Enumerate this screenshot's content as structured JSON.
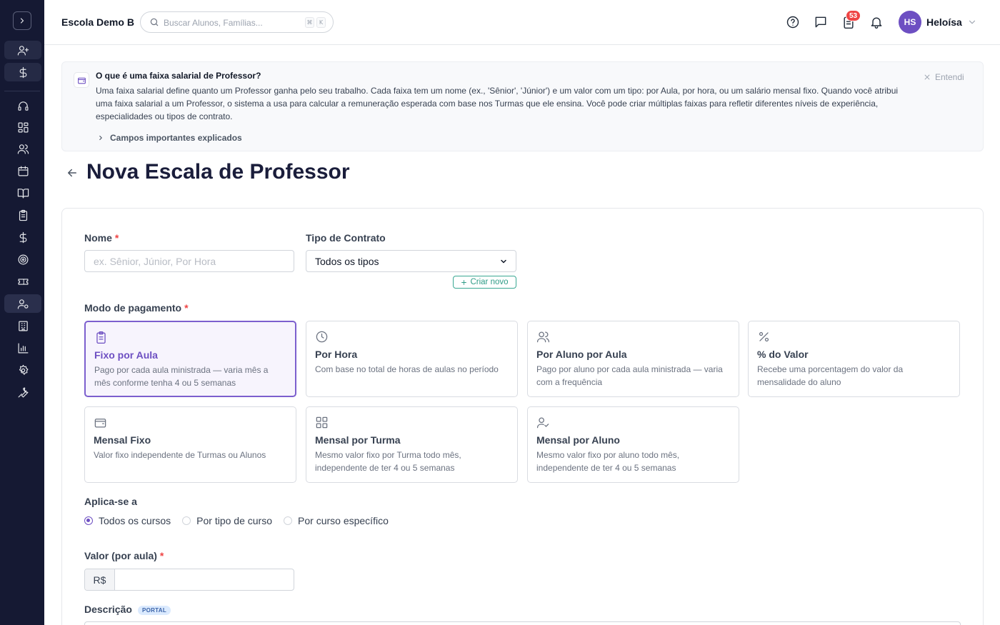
{
  "colors": {
    "sidebar_bg": "#151933",
    "accent": "#6d4fc2",
    "success": "#2f9c87",
    "badge": "#ef4444"
  },
  "sidebar": {
    "icons": [
      "chevron-right-icon",
      "user-plus-icon",
      "dollar-icon",
      "headset-icon",
      "dashboard-icon",
      "users-icon",
      "calendar-icon",
      "book-icon",
      "clipboard-icon",
      "dollar-icon",
      "target-icon",
      "ticket-icon",
      "user-cog-icon",
      "building-icon",
      "chart-icon",
      "settings-icon",
      "wrench-icon"
    ]
  },
  "topbar": {
    "school_name": "Escola Demo B",
    "search_placeholder": "Buscar Alunos, Famílias...",
    "shortcut_keys": [
      "⌘",
      "K"
    ],
    "notification_count": "53",
    "user_initials": "HS",
    "user_name": "Heloísa"
  },
  "banner": {
    "title": "O que é uma faixa salarial de Professor?",
    "text": "Uma faixa salarial define quanto um Professor ganha pelo seu trabalho. Cada faixa tem um nome (ex., 'Sênior', 'Júnior') e um valor com um tipo: por Aula, por hora, ou um salário mensal fixo. Quando você atribui uma faixa salarial a um Professor, o sistema a usa para calcular a remuneração esperada com base nos Turmas que ele ensina. Você pode criar múltiplas faixas para refletir diferentes níveis de experiência, especialidades ou tipos de contrato.",
    "dismiss_label": "Entendi",
    "expand_label": "Campos importantes explicados"
  },
  "page": {
    "title": "Nova Escala de Professor"
  },
  "form": {
    "name_label": "Nome",
    "name_placeholder": "ex. Sênior, Júnior, Por Hora",
    "contract_label": "Tipo de Contrato",
    "contract_value": "Todos os tipos",
    "create_new_label": "Criar novo",
    "payment_mode_label": "Modo de pagamento",
    "payment_modes": [
      {
        "icon": "clipboard-icon",
        "title": "Fixo por Aula",
        "description": "Pago por cada aula ministrada — varia mês a mês conforme tenha 4 ou 5 semanas",
        "selected": true
      },
      {
        "icon": "clock-icon",
        "title": "Por Hora",
        "description": "Com base no total de horas de aulas no período",
        "selected": false
      },
      {
        "icon": "users-icon",
        "title": "Por Aluno por Aula",
        "description": "Pago por aluno por cada aula ministrada — varia com a frequência",
        "selected": false
      },
      {
        "icon": "percent-icon",
        "title": "% do Valor",
        "description": "Recebe uma porcentagem do valor da mensalidade do aluno",
        "selected": false
      },
      {
        "icon": "wallet-icon",
        "title": "Mensal Fixo",
        "description": "Valor fixo independente de Turmas ou Alunos",
        "selected": false
      },
      {
        "icon": "grid-icon",
        "title": "Mensal por Turma",
        "description": "Mesmo valor fixo por Turma todo mês, independente de ter 4 ou 5 semanas",
        "selected": false
      },
      {
        "icon": "user-check-icon",
        "title": "Mensal por Aluno",
        "description": "Mesmo valor fixo por aluno todo mês, independente de ter 4 ou 5 semanas",
        "selected": false
      }
    ],
    "applies_label": "Aplica-se a",
    "applies_options": [
      {
        "label": "Todos os cursos",
        "checked": true
      },
      {
        "label": "Por tipo de curso",
        "checked": false
      },
      {
        "label": "Por curso específico",
        "checked": false
      }
    ],
    "value_label": "Valor (por aula)",
    "currency_prefix": "R$",
    "description_label": "Descrição",
    "portal_tag": "PORTAL",
    "required_mark": "*"
  }
}
